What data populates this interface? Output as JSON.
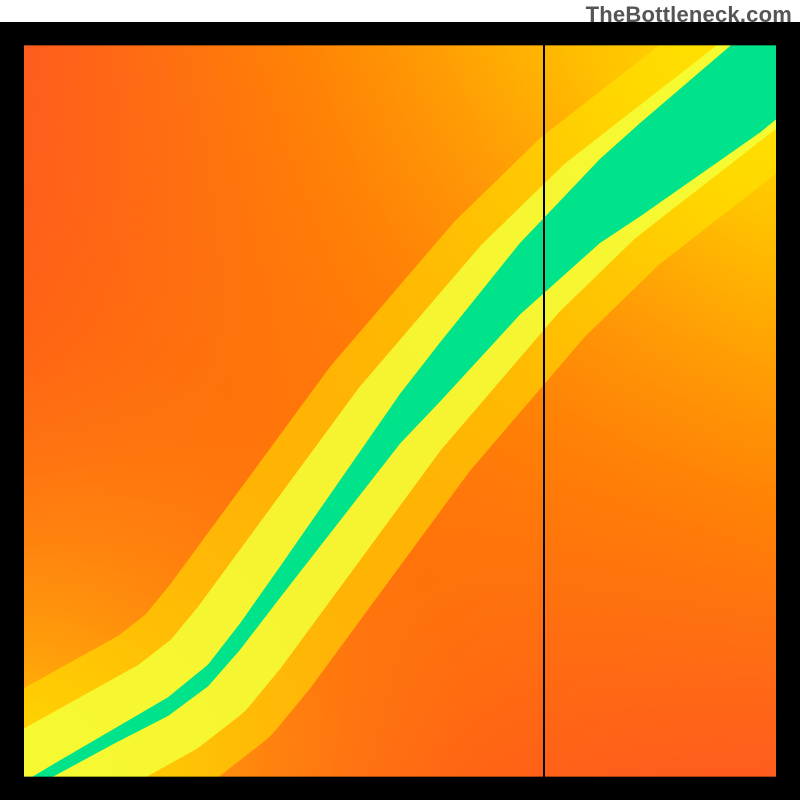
{
  "watermark": "TheBottleneck.com",
  "chart_data": {
    "type": "heatmap",
    "title": "",
    "xlabel": "",
    "ylabel": "",
    "xlim": [
      0,
      100
    ],
    "ylim": [
      0,
      100
    ],
    "colorscale": {
      "0.0": "#ff2a3f",
      "0.25": "#ff8a00",
      "0.5": "#ffe800",
      "0.75": "#8cff3a",
      "1.0": "#00e38a"
    },
    "ridge_centerline": [
      {
        "x": 0,
        "y": 0
      },
      {
        "x": 7,
        "y": 4
      },
      {
        "x": 14,
        "y": 8
      },
      {
        "x": 21,
        "y": 12
      },
      {
        "x": 26,
        "y": 16
      },
      {
        "x": 30,
        "y": 21
      },
      {
        "x": 35,
        "y": 28
      },
      {
        "x": 40,
        "y": 35
      },
      {
        "x": 45,
        "y": 42
      },
      {
        "x": 50,
        "y": 49
      },
      {
        "x": 55,
        "y": 55
      },
      {
        "x": 60,
        "y": 61
      },
      {
        "x": 65,
        "y": 67
      },
      {
        "x": 70,
        "y": 72
      },
      {
        "x": 75,
        "y": 77
      },
      {
        "x": 80,
        "y": 81
      },
      {
        "x": 85,
        "y": 85
      },
      {
        "x": 90,
        "y": 89
      },
      {
        "x": 95,
        "y": 93
      },
      {
        "x": 100,
        "y": 97
      }
    ],
    "ridge_halfwidth": [
      {
        "x": 0,
        "w": 1.5
      },
      {
        "x": 20,
        "w": 2.5
      },
      {
        "x": 40,
        "w": 4
      },
      {
        "x": 60,
        "w": 6
      },
      {
        "x": 80,
        "w": 8
      },
      {
        "x": 100,
        "w": 10
      }
    ],
    "crosshair": {
      "x": 68,
      "y": 0
    },
    "border_color": "#000000"
  }
}
